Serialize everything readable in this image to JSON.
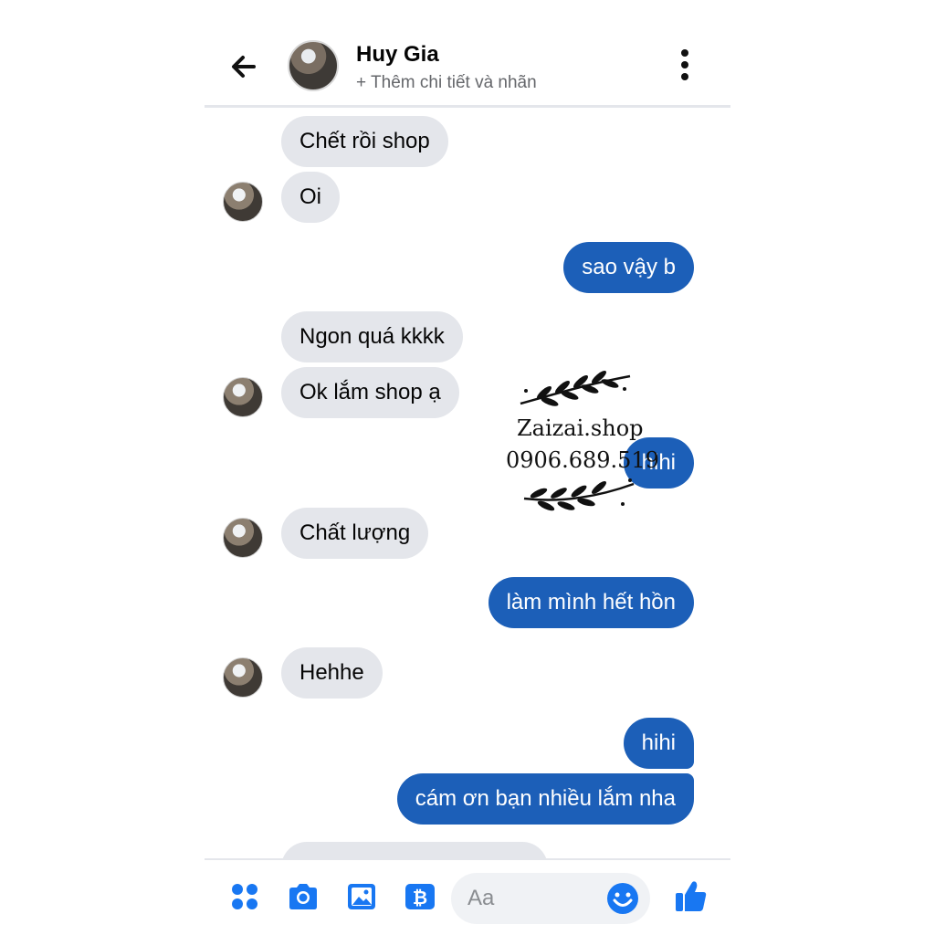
{
  "header": {
    "contact_name": "Huy Gia",
    "subtitle": "+ Thêm chi tiết và nhãn"
  },
  "messages": [
    {
      "from": "them",
      "text": "Chết rồi shop"
    },
    {
      "from": "them",
      "text": "Oi"
    },
    {
      "from": "me",
      "text": "sao vậy b"
    },
    {
      "from": "them",
      "text": "Ngon quá kkkk"
    },
    {
      "from": "them",
      "text": "Ok lắm shop ạ"
    },
    {
      "from": "me",
      "text": "hihi"
    },
    {
      "from": "them",
      "text": "Chất lượng"
    },
    {
      "from": "me",
      "text": "làm mình hết hồn"
    },
    {
      "from": "them",
      "text": "Hehhe"
    },
    {
      "from": "me",
      "text": "hihi"
    },
    {
      "from": "me",
      "text": "cám ơn bạn nhiều lắm nha"
    }
  ],
  "watermark": {
    "shop": "Zaizai.shop",
    "phone": "0906.689.519"
  },
  "composer": {
    "placeholder": "Aa"
  },
  "colors": {
    "outgoing_bubble": "#1c5fb8",
    "incoming_bubble": "#e4e6eb",
    "accent": "#1877f2"
  },
  "icons": [
    "back-arrow-icon",
    "more-options-icon",
    "apps-grid-icon",
    "camera-icon",
    "gallery-icon",
    "payment-icon",
    "emoji-icon",
    "like-icon"
  ]
}
